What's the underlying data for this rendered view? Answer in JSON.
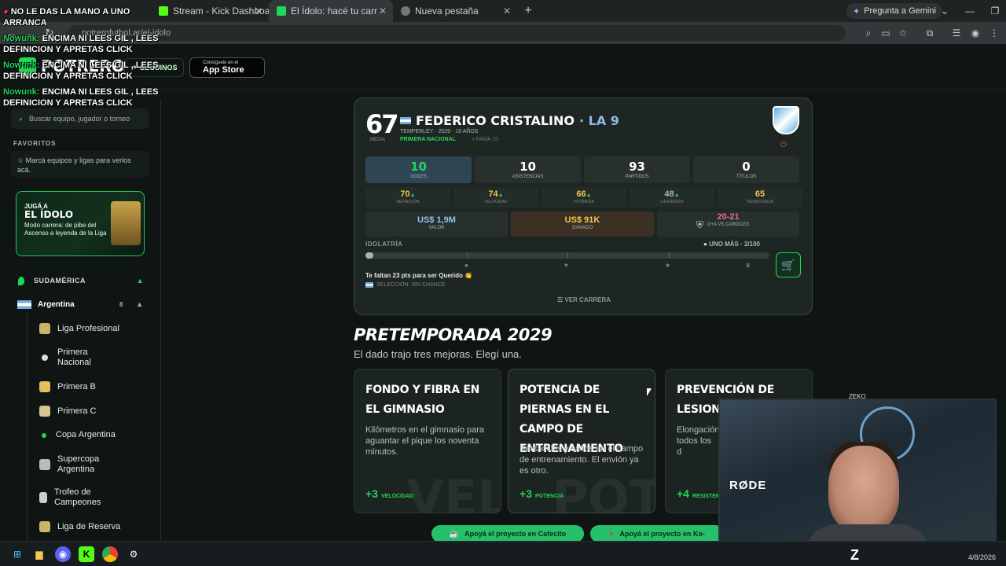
{
  "browser": {
    "tabs": [
      {
        "label": "Stream - Kick Dashboard"
      },
      {
        "label": "El Ídolo: hacé tu carrera en la L"
      },
      {
        "label": "Nueva pestaña"
      }
    ],
    "gemini_label": "Pregunta a Gemini",
    "url": "potrerofutbol.ar/el-idolo"
  },
  "site": {
    "logo": "POTRERO",
    "follow_label": "SEGUINOS",
    "appstore_small": "Consíguelo en el",
    "appstore_big": "App Store"
  },
  "sidebar": {
    "search_placeholder": "Buscar equipo, jugador o torneo",
    "favorites_title": "FAVORITOS",
    "favorites_hint": "Marcá equipos y ligas para verlos acá.",
    "promo": {
      "line1": "JUGÁ A",
      "line2": "EL ÍDOLO",
      "line3": "Modo carrera: de pibe del Ascenso a leyenda de la Liga"
    },
    "region": "SUDAMÉRICA",
    "country": "Argentina",
    "country_count": "8",
    "leagues": [
      "Liga Profesional",
      "Primera Nacional",
      "Primera B",
      "Primera C",
      "Copa Argentina",
      "Supercopa Argentina",
      "Trofeo de Campeones",
      "Liga de Reserva"
    ]
  },
  "player": {
    "overall": "67",
    "overall_label": "MEDIA",
    "name": "FEDERICO CRISTALINO",
    "position": "· LA 9",
    "info": "TEMPERLEY · 2029 · 19 AÑOS",
    "league": "PRIMERA NACIONAL",
    "fame": "FAMA 15",
    "stats": [
      {
        "value": "10",
        "label": "GOLES"
      },
      {
        "value": "10",
        "label": "ASISTENCIAS"
      },
      {
        "value": "93",
        "label": "PARTIDOS"
      },
      {
        "value": "0",
        "label": "TÍTULOS"
      }
    ],
    "attributes": [
      {
        "value": "70",
        "label": "DEFINICIÓN",
        "color": "#f2c94c"
      },
      {
        "value": "74",
        "label": "VELOCIDAD",
        "color": "#f2c94c"
      },
      {
        "value": "66",
        "label": "POTENCIA",
        "color": "#f2c94c"
      },
      {
        "value": "48",
        "label": "LIDERAZGO",
        "color": "#aab5b0"
      },
      {
        "value": "65",
        "label": "RESISTENCIA",
        "color": "#f2c94c"
      }
    ],
    "money": [
      {
        "value": "US$ 1,9M",
        "label": "VALOR"
      },
      {
        "value": "US$ 91K",
        "label": "GANADO"
      }
    ],
    "duel_score": "20-21",
    "duel_label": "G+A VS CARDOZO",
    "idol_label": "IDOLATRÍA",
    "idol_status": "UNO MÁS · 2/100",
    "idol_progress": 0.02,
    "need_text": "Te faltan 23 pts para ser Querido 👏",
    "selection_text": "SELECCIÓN: SIN CHANCE",
    "career_link": "VER CARRERA"
  },
  "preseason": {
    "title": "PRETEMPORADA 2029",
    "subtitle": "El dado trajo tres mejoras. Elegí una.",
    "choices": [
      {
        "title": "FONDO Y FIBRA EN EL GIMNASIO",
        "desc": "Kilómetros en el gimnasio para aguantar el pique los noventa minutos.",
        "bonus": "+3",
        "stat": "VELOCIDAD",
        "watermark": "VEL"
      },
      {
        "title": "POTENCIA DE PIERNAS EN EL CAMPO DE ENTRENAMIENTO",
        "desc": "Sentadillas y saltos en el campo de entrenamiento. El envión ya es otro.",
        "bonus": "+3",
        "stat": "POTENCIA",
        "watermark": "POT"
      },
      {
        "title": "PREVENCIÓN DE LESIONES EN SOLED",
        "desc": "Elongación todos los d",
        "bonus": "+4",
        "stat": "RESISTEN",
        "watermark": ""
      }
    ],
    "support": [
      {
        "label": "Apoyá el proyecto en Cafecito"
      },
      {
        "label": "Apoyá el proyecto en Ko-"
      }
    ]
  },
  "overlay": {
    "lines": [
      {
        "user": "",
        "text": "NO LE DAS LA MANO A UNO ARRANCA"
      },
      {
        "user": "Nowunk:",
        "text": "ENCIMA NI LEES GIL , LEES DEFINICION Y APRETAS CLICK"
      },
      {
        "user": "Nowunk:",
        "text": "ENCIMA NI LEES GIL , LEES DEFINICION Y APRETAS CLICK"
      },
      {
        "user": "Nowunk:",
        "text": "ENCIMA NI LEES GIL , LEES DEFINICION Y APRETAS CLICK"
      }
    ],
    "cam_brand": "RØDE",
    "cam_tag": "ZEKO"
  },
  "taskbar": {
    "date": "4/8/2026"
  }
}
